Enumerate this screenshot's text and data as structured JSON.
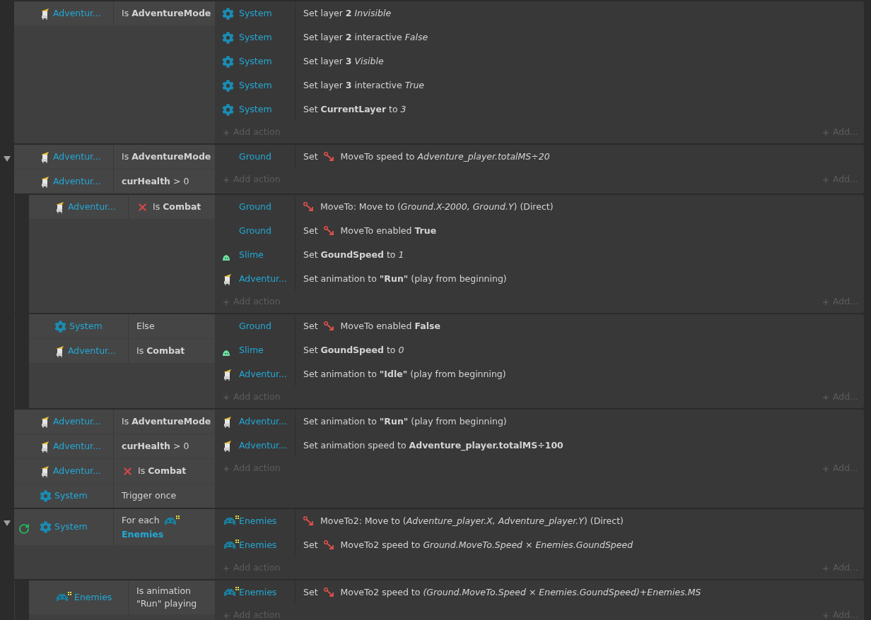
{
  "events": [
    {
      "loop": false,
      "add_action": "Add action",
      "add_more": "Add...",
      "conditions": [
        {
          "kind": "sprite",
          "object": "Adventur...",
          "text": "Is **AdventureMode**",
          "inverted": false
        }
      ],
      "actions": [
        {
          "kind": "system",
          "object": "System",
          "text": "Set layer **2** *Invisible*",
          "behavior": false
        },
        {
          "kind": "system",
          "object": "System",
          "text": "Set layer **2** interactive *False*",
          "behavior": false
        },
        {
          "kind": "system",
          "object": "System",
          "text": "Set layer **3** *Visible*",
          "behavior": false
        },
        {
          "kind": "system",
          "object": "System",
          "text": "Set layer **3** interactive *True*",
          "behavior": false
        },
        {
          "kind": "system",
          "object": "System",
          "text": "Set **CurrentLayer** to *3*",
          "behavior": false
        }
      ]
    },
    {
      "expanded": true,
      "loop": false,
      "add_action": "Add action",
      "add_more": "Add...",
      "conditions": [
        {
          "kind": "sprite",
          "object": "Adventur...",
          "text": "Is **AdventureMode**",
          "inverted": false
        },
        {
          "kind": "sprite",
          "object": "Adventur...",
          "text": "**curHealth** > 0",
          "inverted": false
        }
      ],
      "actions": [
        {
          "kind": "plain",
          "object": "Ground",
          "lead": "Set",
          "text": "MoveTo speed to *Adventure_player.totalMS÷20*",
          "behavior": true
        }
      ],
      "children": [
        {
          "loop": false,
          "add_action": "Add action",
          "add_more": "Add...",
          "conditions": [
            {
              "kind": "sprite",
              "object": "Adventur...",
              "text": "Is **Combat**",
              "inverted": true
            }
          ],
          "actions": [
            {
              "kind": "plain",
              "object": "Ground",
              "text": "MoveTo: Move to (*Ground.X-2000, Ground.Y*) (Direct)",
              "behavior": true
            },
            {
              "kind": "plain",
              "object": "Ground",
              "lead": "Set",
              "text": "MoveTo enabled **True**",
              "behavior": true
            },
            {
              "kind": "slime",
              "object": "Slime",
              "text": "Set **GoundSpeed** to *1*",
              "behavior": false
            },
            {
              "kind": "sprite",
              "object": "Adventur...",
              "text": "Set animation to **\"Run\"** (play from beginning)",
              "behavior": false
            }
          ]
        },
        {
          "loop": false,
          "add_action": "Add action",
          "add_more": "Add...",
          "conditions": [
            {
              "kind": "system",
              "object": "System",
              "text": "Else",
              "inverted": false
            },
            {
              "kind": "sprite",
              "object": "Adventur...",
              "text": "Is **Combat**",
              "inverted": false
            }
          ],
          "actions": [
            {
              "kind": "plain",
              "object": "Ground",
              "lead": "Set",
              "text": "MoveTo enabled **False**",
              "behavior": true
            },
            {
              "kind": "slime",
              "object": "Slime",
              "text": "Set **GoundSpeed** to *0*",
              "behavior": false
            },
            {
              "kind": "sprite",
              "object": "Adventur...",
              "text": "Set animation to **\"Idle\"** (play from beginning)",
              "behavior": false
            }
          ]
        }
      ]
    },
    {
      "loop": false,
      "add_action": "Add action",
      "add_more": "Add...",
      "conditions": [
        {
          "kind": "sprite",
          "object": "Adventur...",
          "text": "Is **AdventureMode**",
          "inverted": false
        },
        {
          "kind": "sprite",
          "object": "Adventur...",
          "text": "**curHealth** > 0",
          "inverted": false
        },
        {
          "kind": "sprite",
          "object": "Adventur...",
          "text": "Is **Combat**",
          "inverted": true
        },
        {
          "kind": "system",
          "object": "System",
          "text": "Trigger once",
          "inverted": false
        }
      ],
      "actions": [
        {
          "kind": "sprite",
          "object": "Adventur...",
          "text": "Set animation to **\"Run\"** (play from beginning)",
          "behavior": false
        },
        {
          "kind": "sprite",
          "object": "Adventur...",
          "text": "Set animation speed to **Adventure_player.totalMS÷100**",
          "behavior": false
        }
      ]
    },
    {
      "expanded": true,
      "loop": true,
      "add_action": "Add action",
      "add_more": "Add...",
      "conditions": [
        {
          "kind": "system",
          "object": "System",
          "text": "For each",
          "target": {
            "kind": "enemies",
            "name": "Enemies"
          },
          "inverted": false
        }
      ],
      "actions": [
        {
          "kind": "enemies",
          "object": "Enemies",
          "text": "MoveTo2: Move to (*Adventure_player.X, Adventure_player.Y*) (Direct)",
          "behavior": true
        },
        {
          "kind": "enemies",
          "object": "Enemies",
          "lead": "Set",
          "text": "MoveTo2 speed to *Ground.MoveTo.Speed × Enemies.GoundSpeed*",
          "behavior": true
        }
      ],
      "children": [
        {
          "loop": false,
          "add_action": "Add action",
          "add_more": "Add...",
          "conditions": [
            {
              "kind": "enemies",
              "object": "Enemies",
              "text": "Is animation \"Run\" playing",
              "inverted": false
            }
          ],
          "actions": [
            {
              "kind": "enemies",
              "object": "Enemies",
              "lead": "Set",
              "text": "MoveTo2 speed to *(Ground.MoveTo.Speed × Enemies.GoundSpeed)+Enemies.MS*",
              "behavior": true
            }
          ]
        }
      ]
    }
  ]
}
